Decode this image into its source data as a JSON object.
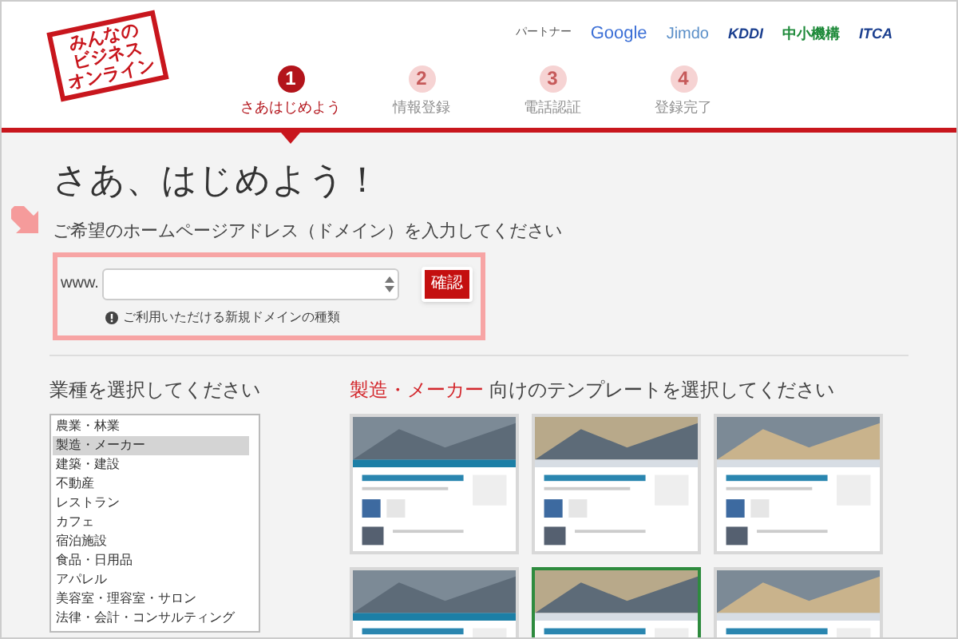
{
  "logo": {
    "lines": [
      "みんなの",
      "ビジネス",
      "オンライン"
    ]
  },
  "partners": {
    "label": "パートナー",
    "logos": [
      "Google",
      "Jimdo",
      "KDDI",
      "中小機構",
      "ITCA"
    ]
  },
  "steps": [
    {
      "number": "1",
      "label": "さあはじめよう",
      "selected": true
    },
    {
      "number": "2",
      "label": "情報登録",
      "selected": false
    },
    {
      "number": "3",
      "label": "電話認証",
      "selected": false
    },
    {
      "number": "4",
      "label": "登録完了",
      "selected": false
    }
  ],
  "title": "さあ、はじめよう！",
  "domain": {
    "instruction": "ご希望のホームページアドレス（ドメイン）を入力してください",
    "prefix": "www.",
    "button": "確認",
    "help": "ご利用いただける新規ドメインの種類"
  },
  "industry": {
    "heading": "業種を選択してください",
    "items": [
      {
        "label": "農業・林業",
        "selected": false
      },
      {
        "label": "製造・メーカー",
        "selected": true
      },
      {
        "label": "建築・建設",
        "selected": false
      },
      {
        "label": "不動産",
        "selected": false
      },
      {
        "label": "レストラン",
        "selected": false
      },
      {
        "label": "カフェ",
        "selected": false
      },
      {
        "label": "宿泊施設",
        "selected": false
      },
      {
        "label": "食品・日用品",
        "selected": false
      },
      {
        "label": "アパレル",
        "selected": false
      },
      {
        "label": "美容室・理容室・サロン",
        "selected": false
      },
      {
        "label": "法律・会計・コンサルティング",
        "selected": false
      }
    ]
  },
  "templates": {
    "heading_highlight": "製造・メーカー",
    "heading_rest": " 向けのテンプレートを選択してください",
    "items": [
      {
        "kind": "picture",
        "selected": false
      },
      {
        "kind": "picture",
        "selected": false
      },
      {
        "kind": "picture",
        "selected": false
      },
      {
        "kind": "picture",
        "selected": false
      },
      {
        "kind": "picture",
        "selected": true
      },
      {
        "kind": "picture",
        "selected": false
      }
    ]
  }
}
